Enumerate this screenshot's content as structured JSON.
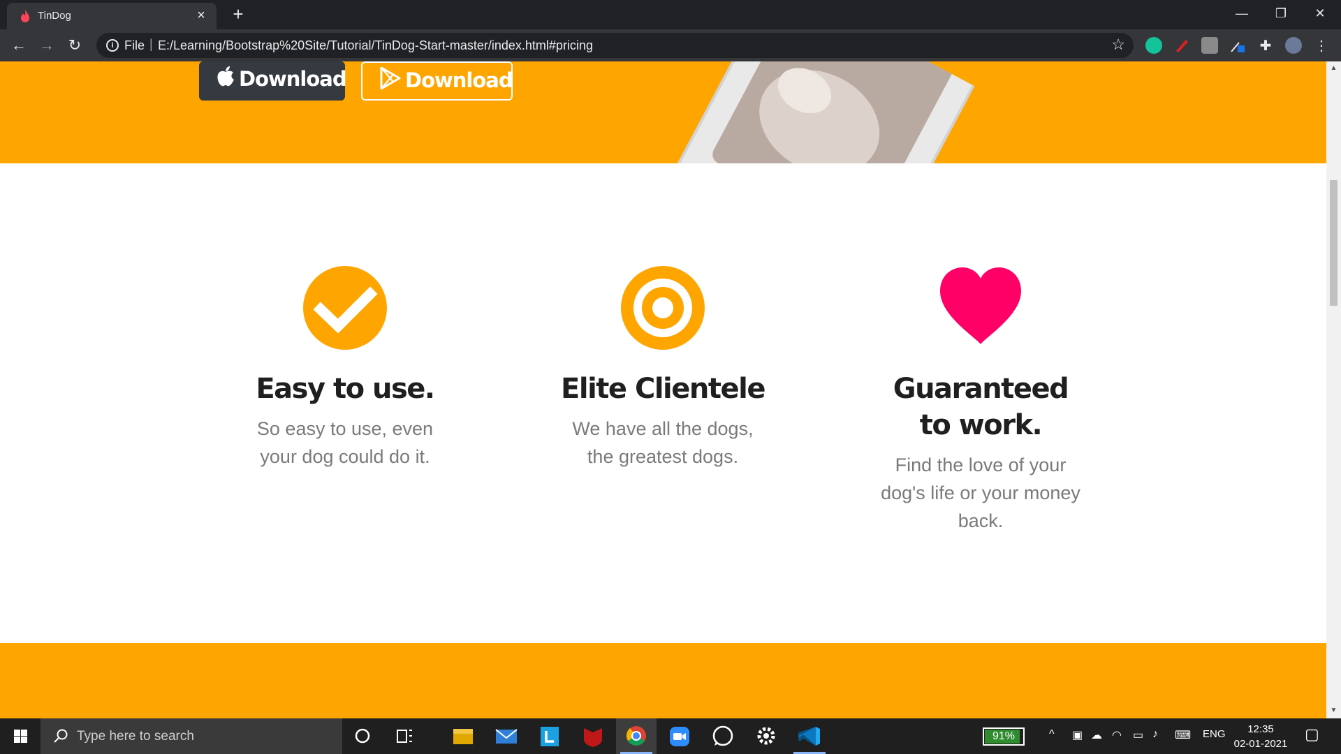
{
  "browser": {
    "tab_title": "TinDog",
    "url_scheme": "File",
    "url": "E:/Learning/Bootstrap%20Site/Tutorial/TinDog-Start-master/index.html#pricing"
  },
  "hero": {
    "apple_download_label": "Download",
    "google_download_label": "Download"
  },
  "features": [
    {
      "title": "Easy to use.",
      "text": "So easy to use, even your dog could do it.",
      "icon": "check-circle-icon"
    },
    {
      "title": "Elite Clientele",
      "text": "We have all the dogs, the greatest dogs.",
      "icon": "bullseye-icon"
    },
    {
      "title": "Guaranteed to work.",
      "text": "Find the love of your dog's life or your money back.",
      "icon": "heart-icon"
    }
  ],
  "colors": {
    "brand_orange": "#ffa500",
    "heart_pink": "#ff0066",
    "dark_button": "#343a40"
  },
  "taskbar": {
    "search_placeholder": "Type here to search",
    "battery": "91%",
    "language": "ENG",
    "time": "12:35",
    "date": "02-01-2021"
  }
}
